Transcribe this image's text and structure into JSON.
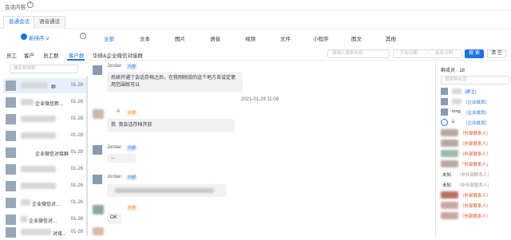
{
  "window": {
    "title": "会话内容"
  },
  "tabs": [
    {
      "label": "普通会话"
    },
    {
      "label": "语音通话"
    }
  ],
  "sidebar": {
    "sort_label": "新排序 ∨",
    "filters": [
      "员工",
      "客户",
      "员工群",
      "客户群"
    ],
    "search_placeholder": "搜名称搜索",
    "items": [
      {
        "name": "群",
        "date": "01-29"
      },
      {
        "name": "企业微信新...",
        "date": "01-26"
      },
      {
        "name": "",
        "date": "01-28"
      },
      {
        "name": "",
        "date": "01-28"
      },
      {
        "name": "企业微信对接群",
        "date": "01-28"
      },
      {
        "name": "",
        "date": "01-26"
      },
      {
        "name": "",
        "date": "01-26"
      },
      {
        "name": "企业微信对...",
        "date": "01-26"
      },
      {
        "name": "企业微信对...",
        "date": "01-26"
      },
      {
        "name": "对接...",
        "date": "01-26"
      }
    ]
  },
  "categories": [
    "全部",
    "文本",
    "图片",
    "语音",
    "视频",
    "文件",
    "小程序",
    "图文",
    "其他"
  ],
  "chat_header": {
    "group_name": "华绕&企业微信对接群",
    "keyword_placeholder": "请输入搜索内容",
    "start_date_placeholder": "开始日期",
    "end_date_placeholder": "结束日期",
    "date_sep": "-",
    "search_button": "搜 索",
    "clear_button": "清 空"
  },
  "messages": {
    "m1": {
      "sender": "Jordan",
      "tag": "内部",
      "text": "后续开通了会话存档之后，在我刚刚说的这个地方去设定使用范围就可以"
    },
    "timestamp": "2021-01-29 11:08",
    "m2": {
      "sender": "A",
      "tag": "外部",
      "text": "我 ‌ 我会话存档开放"
    },
    "m3": {
      "sender": "Jordan",
      "tag": "内部",
      "text": "..."
    },
    "m4": {
      "sender": "Jordan",
      "tag": "内部",
      "text": "‌"
    },
    "m5": {
      "sender": "",
      "tag": "外部",
      "text": "OK"
    }
  },
  "members": {
    "header": "群成员 · 18",
    "search_placeholder": "搜索群成员",
    "list": [
      {
        "name": "",
        "role": "(群主)",
        "role_color": "#1a73e8"
      },
      {
        "name": "",
        "role": "（企业成员）",
        "role_color": "#1a73e8"
      },
      {
        "name": "tong",
        "role": "（企业成员）",
        "role_color": "#1a73e8"
      },
      {
        "name": "ǚ",
        "role": "（企业成员）",
        "role_color": "#1a73e8"
      },
      {
        "name": "",
        "role": "（外部联系人）",
        "role_color": "#e84a1a"
      },
      {
        "name": "",
        "role": "（外部联系人）",
        "role_color": "#e84a1a"
      },
      {
        "name": "",
        "role": "（外部联系人）",
        "role_color": "#e84a1a"
      },
      {
        "name": "",
        "role": "「外部联系人」",
        "role_color": "#e84a1a"
      },
      {
        "name": "未知",
        "role": "（非外部联系人）",
        "role_color": "#999999"
      },
      {
        "name": "未知",
        "role": "（非外部联系人）",
        "role_color": "#999999"
      },
      {
        "name": "",
        "role": "（外部联系人）",
        "role_color": "#e84a1a"
      },
      {
        "name": "",
        "role": "（外部联系人）",
        "role_color": "#e84a1a"
      },
      {
        "name": "",
        "role": "（外部联系人）",
        "role_color": "#e84a1a"
      }
    ]
  }
}
